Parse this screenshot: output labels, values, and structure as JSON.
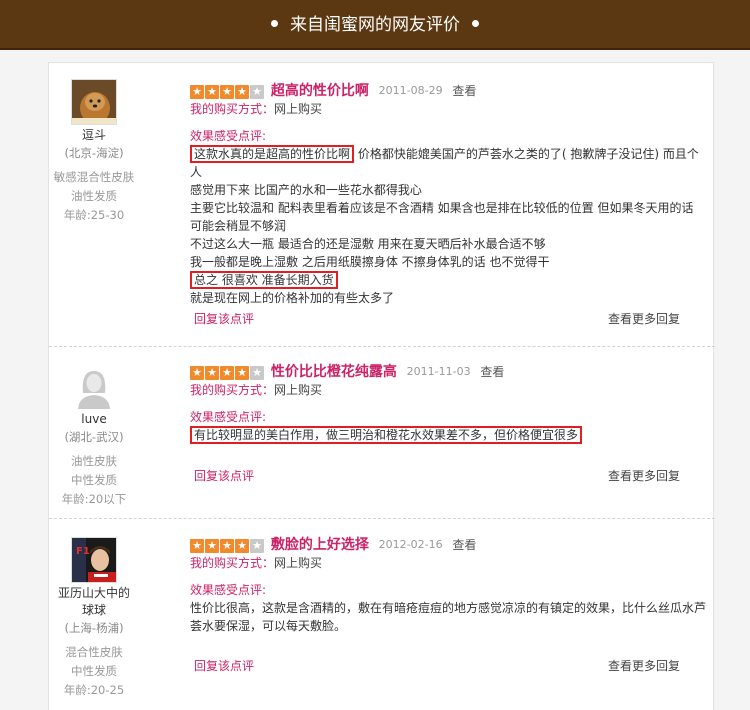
{
  "header": {
    "title": "来自闺蜜网的网友评价"
  },
  "labels": {
    "buy_way": "我的购买方式：",
    "feeling": "效果感受点评:",
    "view": "查看",
    "reply": "回复该点评",
    "more": "查看更多回复"
  },
  "colors": {
    "header_bg": "#5b3812",
    "accent_pink": "#cc2268",
    "star_on": "#f18a2c",
    "star_off": "#c9c9c9",
    "highlight_box": "#e02020"
  },
  "reviews": [
    {
      "user": {
        "name": "逗斗",
        "location": "(北京-海淀)",
        "attrs": [
          "敏感混合性皮肤",
          "油性发质",
          "年龄:25-30"
        ],
        "avatar_icon": "dog-avatar"
      },
      "rating": 4,
      "title": "超高的性价比啊",
      "date": "2011-08-29",
      "buy_way": "网上购买",
      "body": {
        "l1_hl": "这款水真的是超高的性价比啊",
        "l1_rest": " 价格都快能媲美国产的芦荟水之类的了( 抱歉牌子没记住) 而且个人",
        "l2": " 感觉用下来  比国产的水和一些花水都得我心",
        "l3": "主要它比较温和  配料表里看着应该是不含酒精  如果含也是排在比较低的位置  但如果冬天用的话",
        "l4": "可能会稍显不够润",
        "l5": "不过这么大一瓶  最适合的还是湿敷  用来在夏天晒后补水最合适不够",
        "l6": "我一般都是晚上湿敷  之后用纸膜擦身体  不擦身体乳的话  也不觉得干",
        "l7_hl": "总之  很喜欢  准备长期入货",
        "l8": "就是现在网上的价格补加的有些太多了"
      }
    },
    {
      "user": {
        "name": "luve",
        "location": "(湖北-武汉)",
        "attrs": [
          "油性皮肤",
          "中性发质",
          "年龄:20以下"
        ],
        "avatar_icon": "default-female-avatar"
      },
      "rating": 4,
      "title": "性价比比橙花纯露高",
      "date": "2011-11-03",
      "buy_way": "网上购买",
      "body": {
        "l1_hl": "有比较明显的美白作用，做三明治和橙花水效果差不多，但价格便宜很多"
      }
    },
    {
      "user": {
        "name": "亚历山大中的球球",
        "location": "(上海-杨浦)",
        "attrs": [
          "混合性皮肤",
          "中性发质",
          "年龄:20-25"
        ],
        "avatar_icon": "racing-driver-avatar"
      },
      "rating": 4,
      "title": "敷脸的上好选择",
      "date": "2012-02-16",
      "buy_way": "网上购买",
      "body": {
        "l1": "性价比很高，这款是含酒精的，敷在有暗疮痘痘的地方感觉凉凉的有镇定的效果，比什么丝瓜水芦",
        "l2": "荟水要保湿，可以每天敷脸。"
      }
    }
  ]
}
